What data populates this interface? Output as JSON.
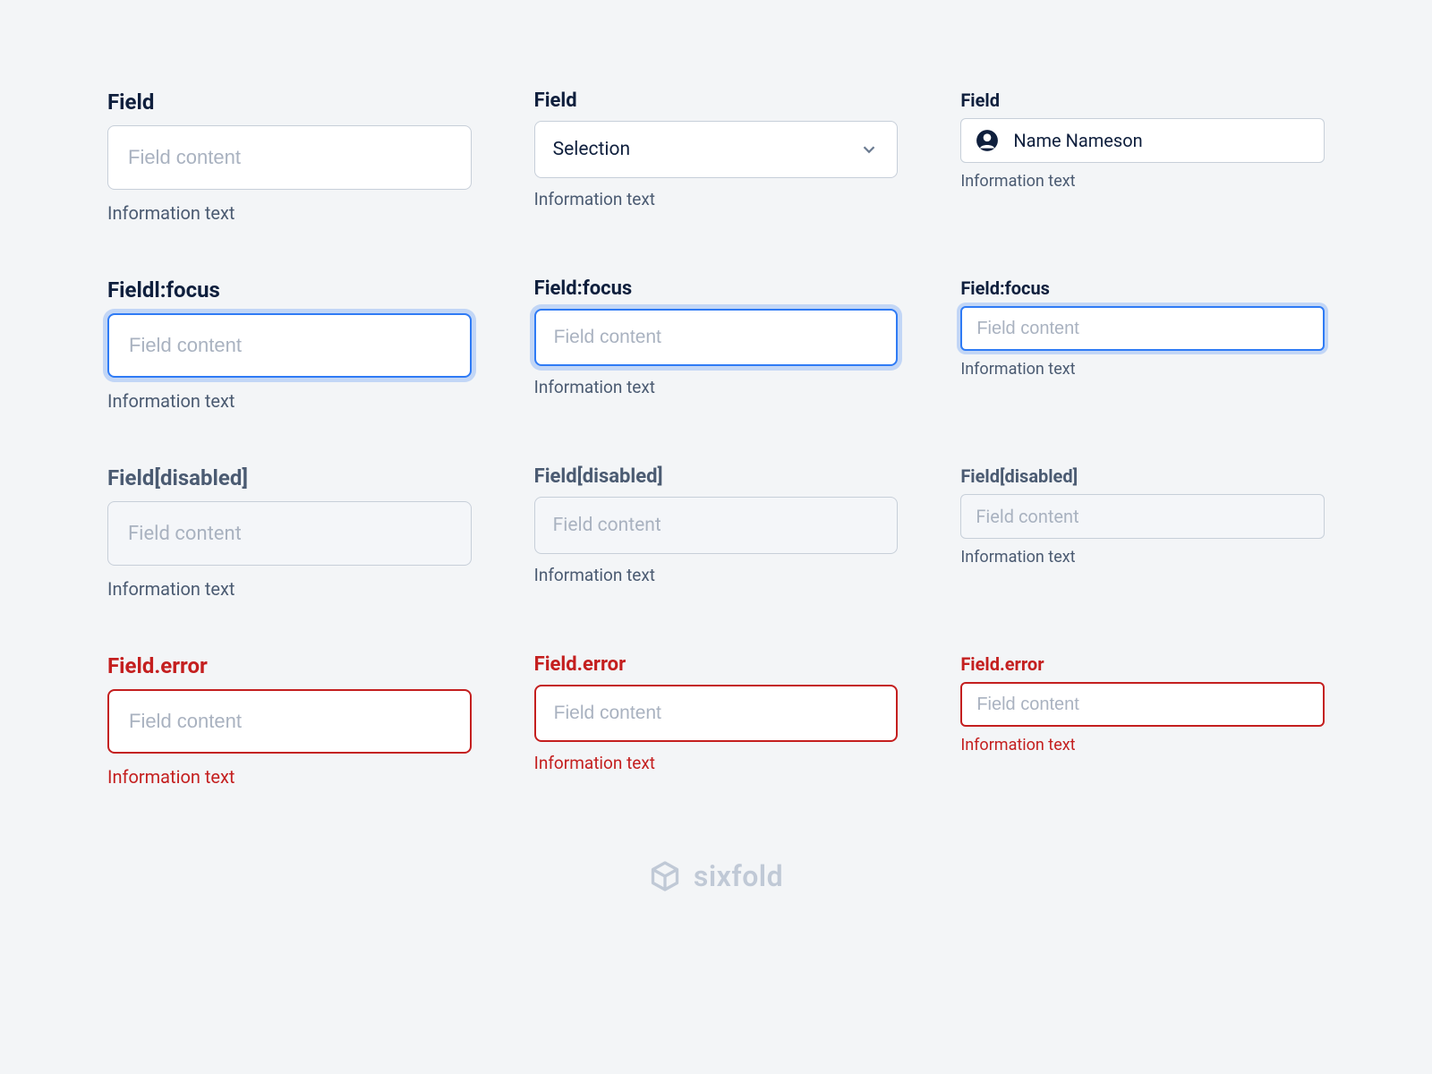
{
  "colors": {
    "background": "#f3f5f7",
    "text_primary": "#0f1f3d",
    "text_secondary": "#4b5b72",
    "placeholder": "#a9b2c0",
    "border": "#c7cfd9",
    "focus": "#2f7bf5",
    "focus_ring": "rgba(47,123,245,0.25)",
    "error": "#c41f1f",
    "logo": "#c0c9d6"
  },
  "columns": [
    {
      "size": "large",
      "rows": [
        {
          "kind": "text",
          "label": "Field",
          "placeholder": "Field content",
          "helper": "Information text"
        },
        {
          "kind": "text",
          "label": "Fieldl:focus",
          "placeholder": "Field content",
          "helper": "Information text",
          "state": "focus"
        },
        {
          "kind": "text",
          "label": "Field[disabled]",
          "placeholder": "Field content",
          "helper": "Information text",
          "state": "disabled"
        },
        {
          "kind": "text",
          "label": "Field.error",
          "placeholder": "Field content",
          "helper": "Information text",
          "state": "error"
        }
      ]
    },
    {
      "size": "medium",
      "rows": [
        {
          "kind": "select",
          "label": "Field",
          "value": "Selection",
          "helper": "Information text"
        },
        {
          "kind": "text",
          "label": "Field:focus",
          "placeholder": "Field content",
          "helper": "Information text",
          "state": "focus"
        },
        {
          "kind": "text",
          "label": "Field[disabled]",
          "placeholder": "Field content",
          "helper": "Information text",
          "state": "disabled"
        },
        {
          "kind": "text",
          "label": "Field.error",
          "placeholder": "Field content",
          "helper": "Information text",
          "state": "error"
        }
      ]
    },
    {
      "size": "small",
      "rows": [
        {
          "kind": "user",
          "label": "Field",
          "value": "Name Nameson",
          "helper": "Information text"
        },
        {
          "kind": "text",
          "label": "Field:focus",
          "placeholder": "Field content",
          "helper": "Information text",
          "state": "focus"
        },
        {
          "kind": "text",
          "label": "Field[disabled]",
          "placeholder": "Field content",
          "helper": "Information text",
          "state": "disabled"
        },
        {
          "kind": "text",
          "label": "Field.error",
          "placeholder": "Field content",
          "helper": "Information text",
          "state": "error"
        }
      ]
    }
  ],
  "logo_text": "sixfold"
}
